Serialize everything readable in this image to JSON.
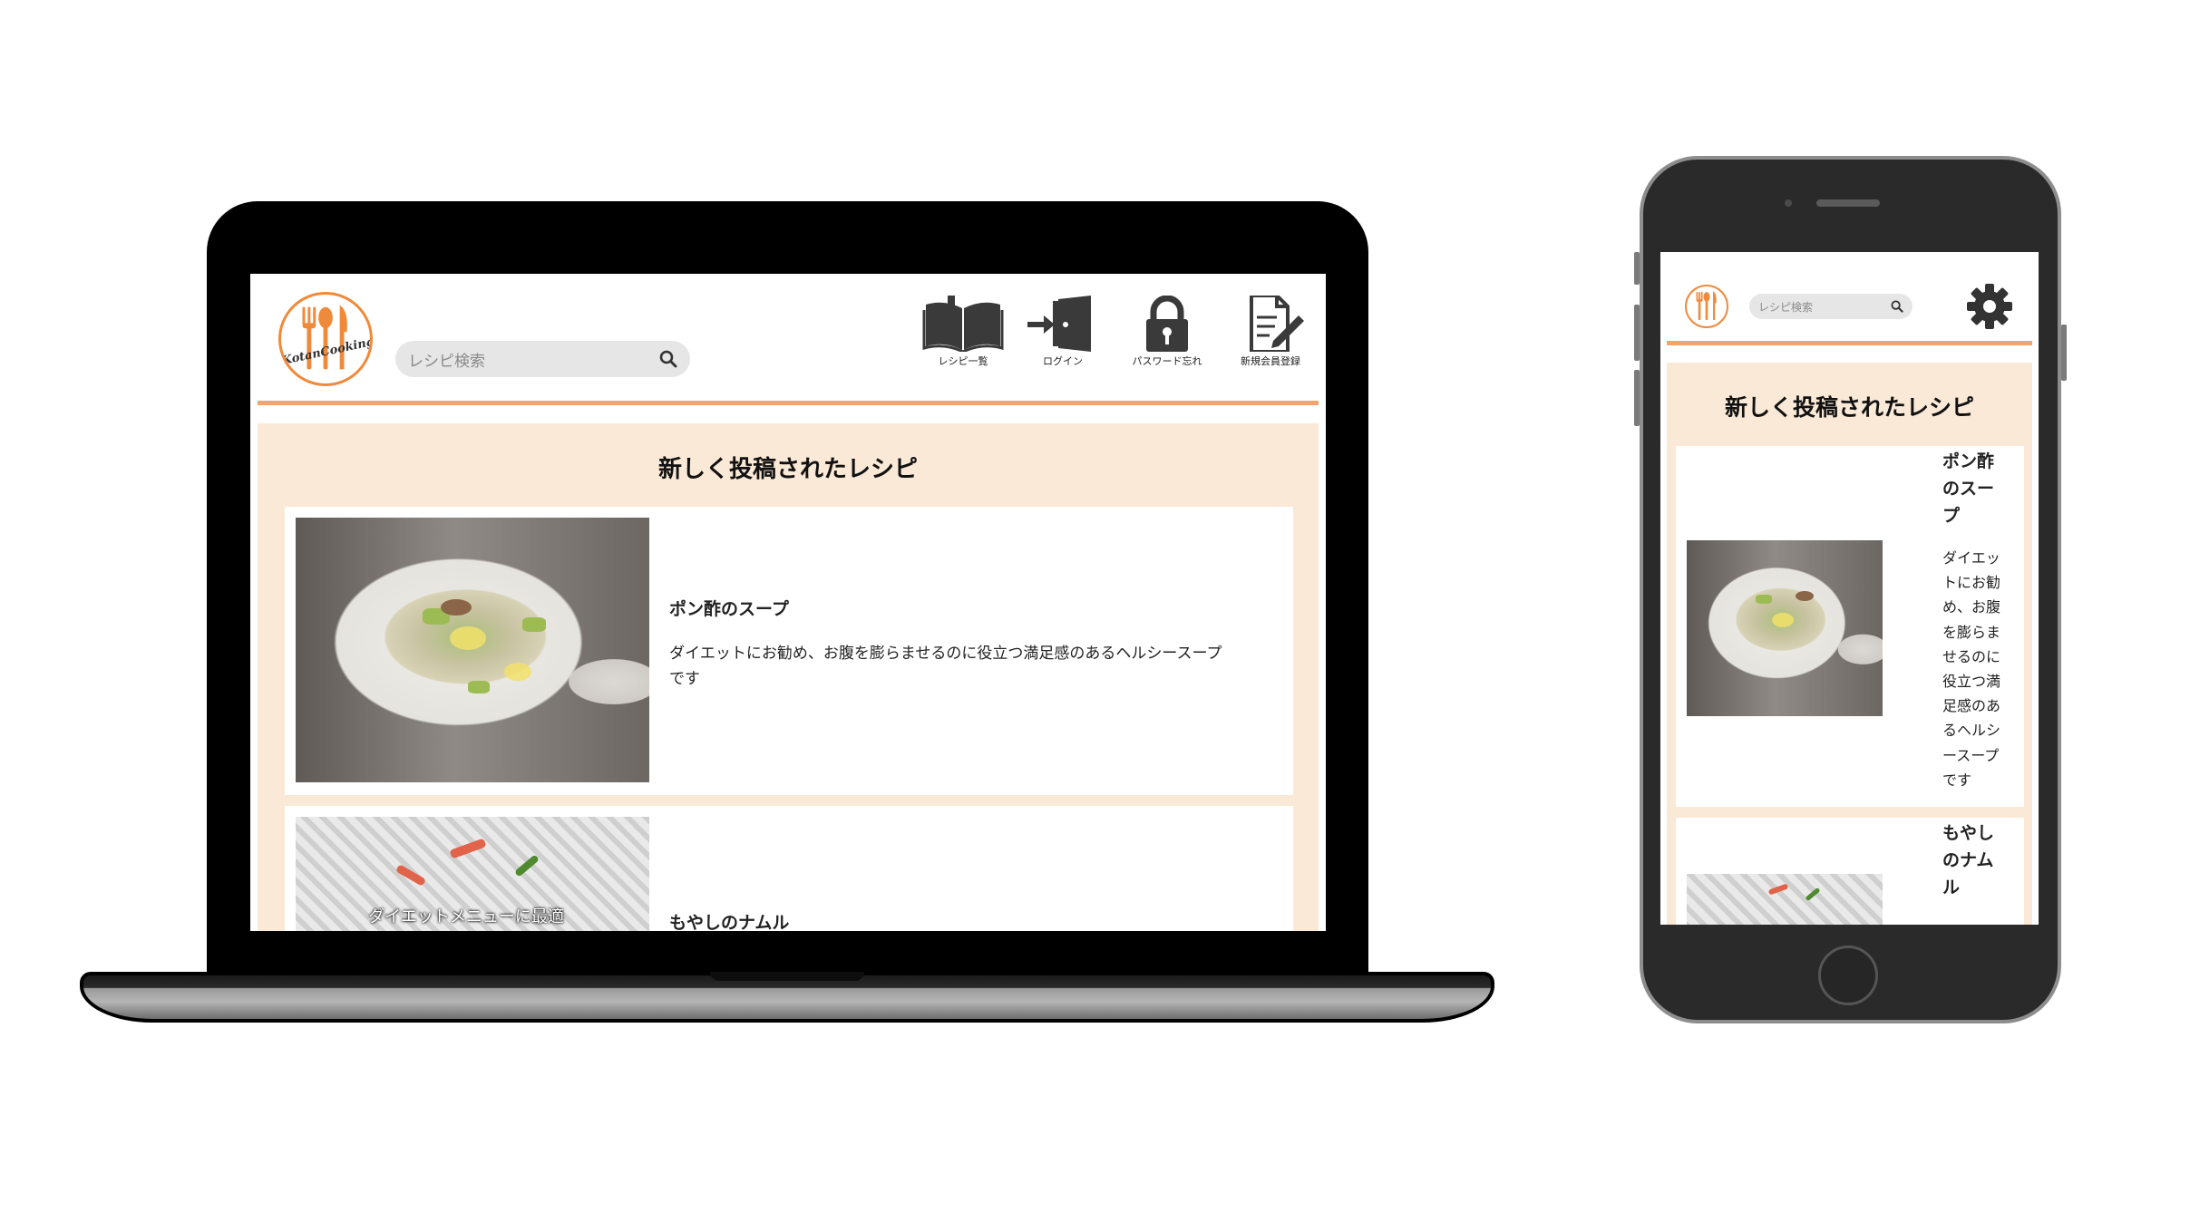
{
  "site": {
    "logo_text": "KotanCooking",
    "search_placeholder": "レシピ検索",
    "nav": [
      {
        "label": "レシピ一覧",
        "icon": "book-icon"
      },
      {
        "label": "ログイン",
        "icon": "login-door-icon"
      },
      {
        "label": "パスワード忘れ",
        "icon": "padlock-icon"
      },
      {
        "label": "新規会員登録",
        "icon": "register-form-icon"
      }
    ],
    "mobile_menu_icon": "gear-icon"
  },
  "main": {
    "section_title": "新しく投稿されたレシピ",
    "recipes": [
      {
        "title": "ポン酢のスープ",
        "title_mobile_lines": [
          "ポン酢",
          "のスー",
          "プ"
        ],
        "description": "ダイエットにお勧め、お腹を膨らませるのに役立つ満足感のあるヘルシースープです",
        "description_desktop_lines": [
          "ダイエットにお勧め、お腹を膨らませるのに役立つ満足感のあるヘルシースープ",
          "です"
        ],
        "description_mobile_lines": [
          "ダイエッ",
          "トにお勧",
          "め、お腹",
          "を膨らま",
          "せるのに",
          "役立つ満",
          "足感のあ",
          "るヘルシ",
          "ースープ",
          "です"
        ]
      },
      {
        "title": "もやしのナムル",
        "title_mobile_lines": [
          "もやし",
          "のナム",
          "ル"
        ],
        "photo_caption": "ダイエットメニューに最適"
      }
    ]
  },
  "colors": {
    "accent": "#f3a46c",
    "panel_background": "#fae9d6",
    "logo_border": "#f08a3b",
    "device_frame": "#000000"
  }
}
